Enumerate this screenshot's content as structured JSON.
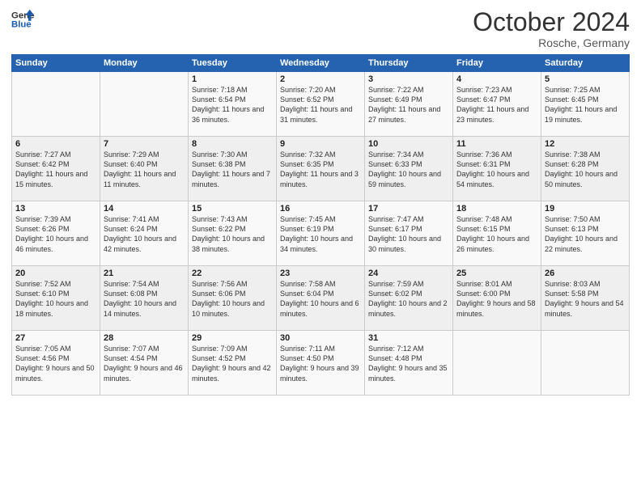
{
  "header": {
    "logo_line1": "General",
    "logo_line2": "Blue",
    "month": "October 2024",
    "location": "Rosche, Germany"
  },
  "days_of_week": [
    "Sunday",
    "Monday",
    "Tuesday",
    "Wednesday",
    "Thursday",
    "Friday",
    "Saturday"
  ],
  "weeks": [
    [
      {
        "day": "",
        "text": ""
      },
      {
        "day": "",
        "text": ""
      },
      {
        "day": "1",
        "text": "Sunrise: 7:18 AM\nSunset: 6:54 PM\nDaylight: 11 hours and 36 minutes."
      },
      {
        "day": "2",
        "text": "Sunrise: 7:20 AM\nSunset: 6:52 PM\nDaylight: 11 hours and 31 minutes."
      },
      {
        "day": "3",
        "text": "Sunrise: 7:22 AM\nSunset: 6:49 PM\nDaylight: 11 hours and 27 minutes."
      },
      {
        "day": "4",
        "text": "Sunrise: 7:23 AM\nSunset: 6:47 PM\nDaylight: 11 hours and 23 minutes."
      },
      {
        "day": "5",
        "text": "Sunrise: 7:25 AM\nSunset: 6:45 PM\nDaylight: 11 hours and 19 minutes."
      }
    ],
    [
      {
        "day": "6",
        "text": "Sunrise: 7:27 AM\nSunset: 6:42 PM\nDaylight: 11 hours and 15 minutes."
      },
      {
        "day": "7",
        "text": "Sunrise: 7:29 AM\nSunset: 6:40 PM\nDaylight: 11 hours and 11 minutes."
      },
      {
        "day": "8",
        "text": "Sunrise: 7:30 AM\nSunset: 6:38 PM\nDaylight: 11 hours and 7 minutes."
      },
      {
        "day": "9",
        "text": "Sunrise: 7:32 AM\nSunset: 6:35 PM\nDaylight: 11 hours and 3 minutes."
      },
      {
        "day": "10",
        "text": "Sunrise: 7:34 AM\nSunset: 6:33 PM\nDaylight: 10 hours and 59 minutes."
      },
      {
        "day": "11",
        "text": "Sunrise: 7:36 AM\nSunset: 6:31 PM\nDaylight: 10 hours and 54 minutes."
      },
      {
        "day": "12",
        "text": "Sunrise: 7:38 AM\nSunset: 6:28 PM\nDaylight: 10 hours and 50 minutes."
      }
    ],
    [
      {
        "day": "13",
        "text": "Sunrise: 7:39 AM\nSunset: 6:26 PM\nDaylight: 10 hours and 46 minutes."
      },
      {
        "day": "14",
        "text": "Sunrise: 7:41 AM\nSunset: 6:24 PM\nDaylight: 10 hours and 42 minutes."
      },
      {
        "day": "15",
        "text": "Sunrise: 7:43 AM\nSunset: 6:22 PM\nDaylight: 10 hours and 38 minutes."
      },
      {
        "day": "16",
        "text": "Sunrise: 7:45 AM\nSunset: 6:19 PM\nDaylight: 10 hours and 34 minutes."
      },
      {
        "day": "17",
        "text": "Sunrise: 7:47 AM\nSunset: 6:17 PM\nDaylight: 10 hours and 30 minutes."
      },
      {
        "day": "18",
        "text": "Sunrise: 7:48 AM\nSunset: 6:15 PM\nDaylight: 10 hours and 26 minutes."
      },
      {
        "day": "19",
        "text": "Sunrise: 7:50 AM\nSunset: 6:13 PM\nDaylight: 10 hours and 22 minutes."
      }
    ],
    [
      {
        "day": "20",
        "text": "Sunrise: 7:52 AM\nSunset: 6:10 PM\nDaylight: 10 hours and 18 minutes."
      },
      {
        "day": "21",
        "text": "Sunrise: 7:54 AM\nSunset: 6:08 PM\nDaylight: 10 hours and 14 minutes."
      },
      {
        "day": "22",
        "text": "Sunrise: 7:56 AM\nSunset: 6:06 PM\nDaylight: 10 hours and 10 minutes."
      },
      {
        "day": "23",
        "text": "Sunrise: 7:58 AM\nSunset: 6:04 PM\nDaylight: 10 hours and 6 minutes."
      },
      {
        "day": "24",
        "text": "Sunrise: 7:59 AM\nSunset: 6:02 PM\nDaylight: 10 hours and 2 minutes."
      },
      {
        "day": "25",
        "text": "Sunrise: 8:01 AM\nSunset: 6:00 PM\nDaylight: 9 hours and 58 minutes."
      },
      {
        "day": "26",
        "text": "Sunrise: 8:03 AM\nSunset: 5:58 PM\nDaylight: 9 hours and 54 minutes."
      }
    ],
    [
      {
        "day": "27",
        "text": "Sunrise: 7:05 AM\nSunset: 4:56 PM\nDaylight: 9 hours and 50 minutes."
      },
      {
        "day": "28",
        "text": "Sunrise: 7:07 AM\nSunset: 4:54 PM\nDaylight: 9 hours and 46 minutes."
      },
      {
        "day": "29",
        "text": "Sunrise: 7:09 AM\nSunset: 4:52 PM\nDaylight: 9 hours and 42 minutes."
      },
      {
        "day": "30",
        "text": "Sunrise: 7:11 AM\nSunset: 4:50 PM\nDaylight: 9 hours and 39 minutes."
      },
      {
        "day": "31",
        "text": "Sunrise: 7:12 AM\nSunset: 4:48 PM\nDaylight: 9 hours and 35 minutes."
      },
      {
        "day": "",
        "text": ""
      },
      {
        "day": "",
        "text": ""
      }
    ]
  ]
}
